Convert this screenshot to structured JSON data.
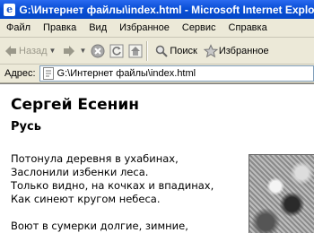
{
  "window": {
    "title": "G:\\Интернет файлы\\index.html - Microsoft Internet Explorer"
  },
  "menu": [
    "Файл",
    "Правка",
    "Вид",
    "Избранное",
    "Сервис",
    "Справка"
  ],
  "toolbar": {
    "back_label": "Назад",
    "search_label": "Поиск",
    "favorites_label": "Избранное"
  },
  "address": {
    "label": "Адрес:",
    "value": "G:\\Интернет файлы\\index.html"
  },
  "page": {
    "heading": "Сергей Есенин",
    "subheading": "Русь",
    "stanza1": [
      "Потонула деревня в ухабинах,",
      "Заслонили избенки леса.",
      "Только видно, на кочках и впадинах,",
      "Как синеют кругом небеса."
    ],
    "stanza2": [
      "Воют в сумерки долгие, зимние,"
    ]
  },
  "colors": {
    "titlebar": "#0a4fd6",
    "chrome": "#ece9d8",
    "stop_button": "#a8a8a8"
  }
}
